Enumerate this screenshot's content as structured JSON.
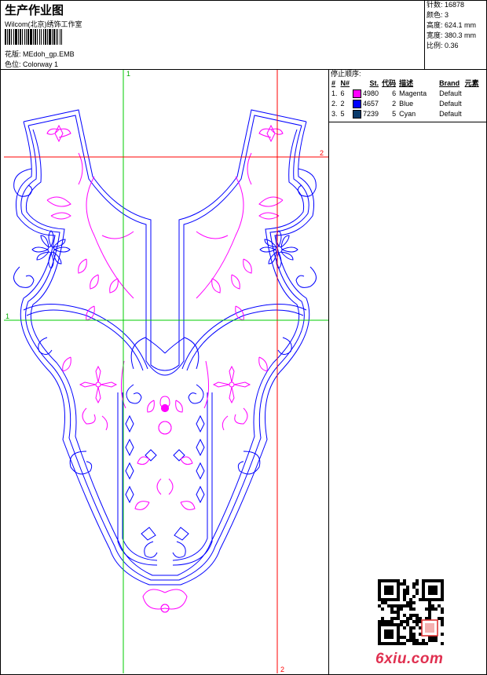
{
  "header": {
    "title": "生产作业图",
    "company": "Wilcom(北京)绣饰工作室",
    "design_label": "花版:",
    "design_value": "MEdoh_gp.EMB",
    "colorway_label": "色位:",
    "colorway_value": "Colorway 1"
  },
  "info": [
    {
      "label": "针数:",
      "value": "16878"
    },
    {
      "label": "颜色:",
      "value": "3"
    },
    {
      "label": "高度:",
      "value": "624.1 mm"
    },
    {
      "label": "宽度:",
      "value": "380.3 mm"
    },
    {
      "label": "比例:",
      "value": "0.36"
    }
  ],
  "stop_sequence": {
    "title": "停止顺序:",
    "columns": [
      "#",
      "N#",
      "St.",
      "代码",
      "描述",
      "Brand",
      "元素"
    ],
    "rows": [
      {
        "idx": "1.",
        "n": "6",
        "color": "#ff00ff",
        "st": "4980",
        "code": "6",
        "desc": "Magenta",
        "brand": "Default"
      },
      {
        "idx": "2.",
        "n": "2",
        "color": "#0000ff",
        "st": "4657",
        "code": "2",
        "desc": "Blue",
        "brand": "Default"
      },
      {
        "idx": "3.",
        "n": "5",
        "color": "#0a3a6a",
        "st": "7239",
        "code": "5",
        "desc": "Cyan",
        "brand": "Default"
      }
    ]
  },
  "guides": {
    "green_label": "1",
    "red_label": "2",
    "green_color": "#00cc00",
    "red_color": "#ff0000"
  },
  "watermark": "6xiu.com",
  "colors": {
    "blue": "#0000ff",
    "magenta": "#ff00ff",
    "navy": "#0a3a6a"
  }
}
